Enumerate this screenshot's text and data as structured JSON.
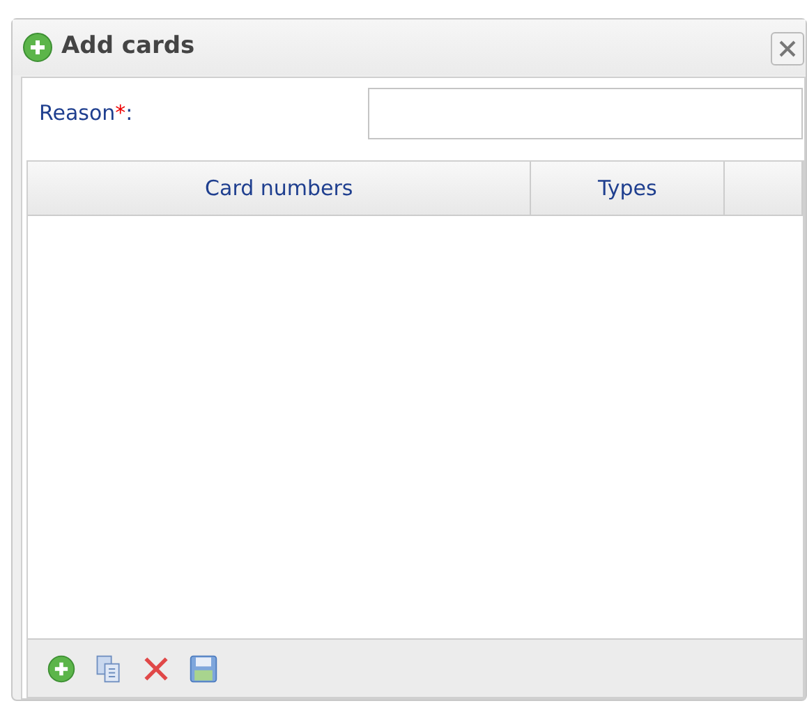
{
  "window": {
    "title": "Add cards"
  },
  "form": {
    "label": "Reason",
    "required_mark": "*",
    "label_suffix": ":"
  },
  "table": {
    "columns": [
      {
        "label": "Card numbers"
      },
      {
        "label": "Types"
      }
    ]
  },
  "toolbar": [
    {
      "kind": "add"
    },
    {
      "kind": "copy"
    },
    {
      "kind": "delete"
    },
    {
      "kind": "save"
    }
  ]
}
